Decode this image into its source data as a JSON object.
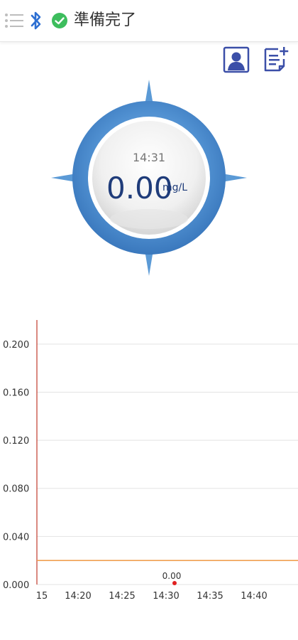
{
  "status": {
    "text": "準備完了",
    "icons": [
      "menu-icon",
      "bluetooth-icon",
      "check-circle-icon"
    ],
    "colors": {
      "bluetooth": "#2d6fd2",
      "ok": "#3dbd5d",
      "accent": "#3b4fa8"
    }
  },
  "toolbar": {
    "icons": [
      "profile-icon",
      "notes-add-icon"
    ]
  },
  "gauge": {
    "time": "14:31",
    "value": "0.00",
    "unit": "mg/L",
    "colors": {
      "ring": "#4f8fd0",
      "spike": "#5b9ad6",
      "value": "#1f3c7a"
    }
  },
  "chart_data": {
    "type": "line",
    "y_ticks": [
      "0.200",
      "0.160",
      "0.120",
      "0.080",
      "0.040",
      "0.000"
    ],
    "x_ticks": [
      "15",
      "14:20",
      "14:25",
      "14:30",
      "14:35",
      "14:40"
    ],
    "ylim": [
      0,
      0.22
    ],
    "threshold": 0.02,
    "threshold_color": "#f0a050",
    "points": [
      {
        "x": "14:30",
        "y": 0.0,
        "label": "0.00"
      }
    ],
    "point_color": "#e02020",
    "grid": true
  }
}
